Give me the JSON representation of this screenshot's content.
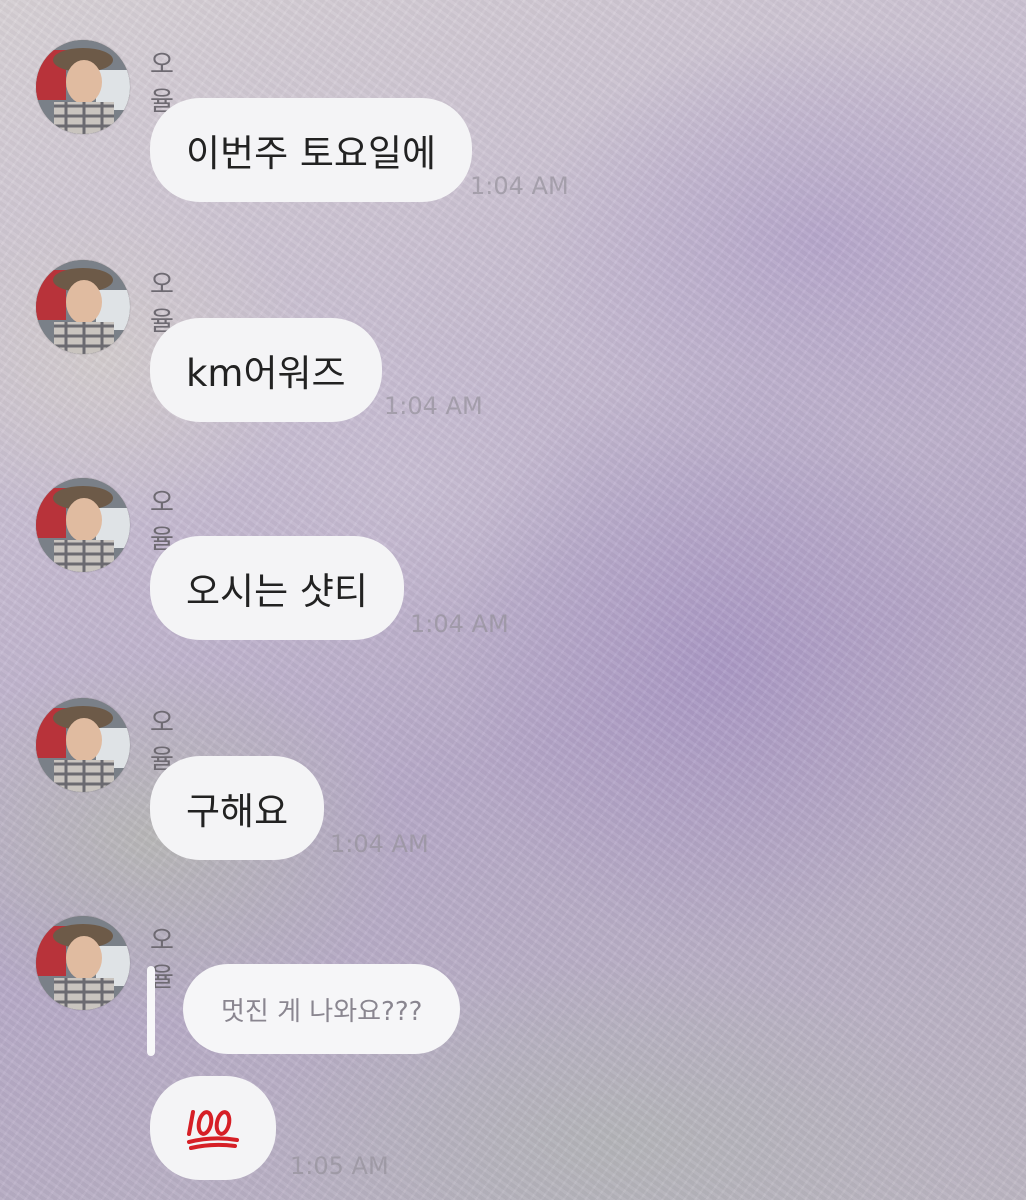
{
  "chat": {
    "messages": [
      {
        "sender": "오율",
        "text": "이번주 토요일에",
        "time": "1:04 AM"
      },
      {
        "sender": "오율",
        "text": "km어워즈",
        "time": "1:04 AM"
      },
      {
        "sender": "오율",
        "text": "오시는 샷티",
        "time": "1:04 AM"
      },
      {
        "sender": "오율",
        "text": "구해요",
        "time": "1:04 AM"
      },
      {
        "sender": "오율",
        "reply_quote": "멋진 게 나와요???",
        "emoji": "hundred-points-emoji",
        "emoji_text": "💯",
        "time": "1:05 AM"
      }
    ]
  },
  "colors": {
    "bubble": "#f4f4f6",
    "emoji_red": "#d61f26"
  }
}
